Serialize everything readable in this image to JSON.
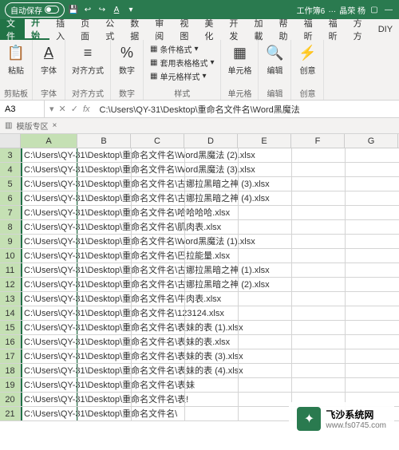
{
  "titlebar": {
    "auto_save": "自动保存",
    "workbook": "工作簿6",
    "user": "晶荣 杨"
  },
  "tabs": [
    "文件",
    "开始",
    "插入",
    "页面",
    "公式",
    "数据",
    "审阅",
    "视图",
    "美化",
    "开发",
    "加載",
    "帮助",
    "福昕",
    "福昕",
    "方方",
    "DIY"
  ],
  "active_tab_index": 1,
  "ribbon": {
    "clipboard": {
      "paste": "粘贴",
      "label": "剪贴板"
    },
    "font": {
      "btn": "字体",
      "label": "字体"
    },
    "align": {
      "btn": "对齐方式",
      "label": "对齐方式"
    },
    "number": {
      "btn": "数字",
      "label": "数字"
    },
    "format": {
      "cond": "条件格式",
      "table": "套用表格格式",
      "cell": "单元格样式",
      "label": "样式"
    },
    "cells": {
      "btn": "单元格",
      "label": "单元格"
    },
    "edit": {
      "btn": "编辑",
      "label": "编辑"
    },
    "idea": {
      "btn": "创意",
      "label": "创意"
    }
  },
  "cellref": {
    "name": "A3",
    "fx": "fx",
    "formula": "C:\\Users\\QY-31\\Desktop\\重命名文件名\\Word黑魔法"
  },
  "mode_bar": "模版专区",
  "columns": [
    "A",
    "B",
    "C",
    "D",
    "E",
    "F",
    "G"
  ],
  "rows": [
    {
      "n": 3,
      "v": "C:\\Users\\QY-31\\Desktop\\重命名文件名\\Word黑魔法 (2).xlsx"
    },
    {
      "n": 4,
      "v": "C:\\Users\\QY-31\\Desktop\\重命名文件名\\Word黑魔法 (3).xlsx"
    },
    {
      "n": 5,
      "v": "C:\\Users\\QY-31\\Desktop\\重命名文件名\\古娜拉黑暗之神 (3).xlsx"
    },
    {
      "n": 6,
      "v": "C:\\Users\\QY-31\\Desktop\\重命名文件名\\古娜拉黑暗之神 (4).xlsx"
    },
    {
      "n": 7,
      "v": "C:\\Users\\QY-31\\Desktop\\重命名文件名\\哈哈哈哈.xlsx"
    },
    {
      "n": 8,
      "v": "C:\\Users\\QY-31\\Desktop\\重命名文件名\\肌肉表.xlsx"
    },
    {
      "n": 9,
      "v": "C:\\Users\\QY-31\\Desktop\\重命名文件名\\Word黑魔法 (1).xlsx"
    },
    {
      "n": 10,
      "v": "C:\\Users\\QY-31\\Desktop\\重命名文件名\\巴拉能量.xlsx"
    },
    {
      "n": 11,
      "v": "C:\\Users\\QY-31\\Desktop\\重命名文件名\\古娜拉黑暗之神 (1).xlsx"
    },
    {
      "n": 12,
      "v": "C:\\Users\\QY-31\\Desktop\\重命名文件名\\古娜拉黑暗之神 (2).xlsx"
    },
    {
      "n": 13,
      "v": "C:\\Users\\QY-31\\Desktop\\重命名文件名\\牛肉表.xlsx"
    },
    {
      "n": 14,
      "v": "C:\\Users\\QY-31\\Desktop\\重命名文件名\\123124.xlsx"
    },
    {
      "n": 15,
      "v": "C:\\Users\\QY-31\\Desktop\\重命名文件名\\表妹的表 (1).xlsx"
    },
    {
      "n": 16,
      "v": "C:\\Users\\QY-31\\Desktop\\重命名文件名\\表妹的表.xlsx"
    },
    {
      "n": 17,
      "v": "C:\\Users\\QY-31\\Desktop\\重命名文件名\\表妹的表 (3).xlsx"
    },
    {
      "n": 18,
      "v": "C:\\Users\\QY-31\\Desktop\\重命名文件名\\表妹的表 (4).xlsx"
    },
    {
      "n": 19,
      "v": "C:\\Users\\QY-31\\Desktop\\重命名文件名\\表妹"
    },
    {
      "n": 20,
      "v": "C:\\Users\\QY-31\\Desktop\\重命名文件名\\表!"
    },
    {
      "n": 21,
      "v": "C:\\Users\\QY-31\\Desktop\\重命名文件名\\"
    }
  ],
  "watermark": {
    "name": "飞沙系统网",
    "url": "www.fs0745.com"
  }
}
